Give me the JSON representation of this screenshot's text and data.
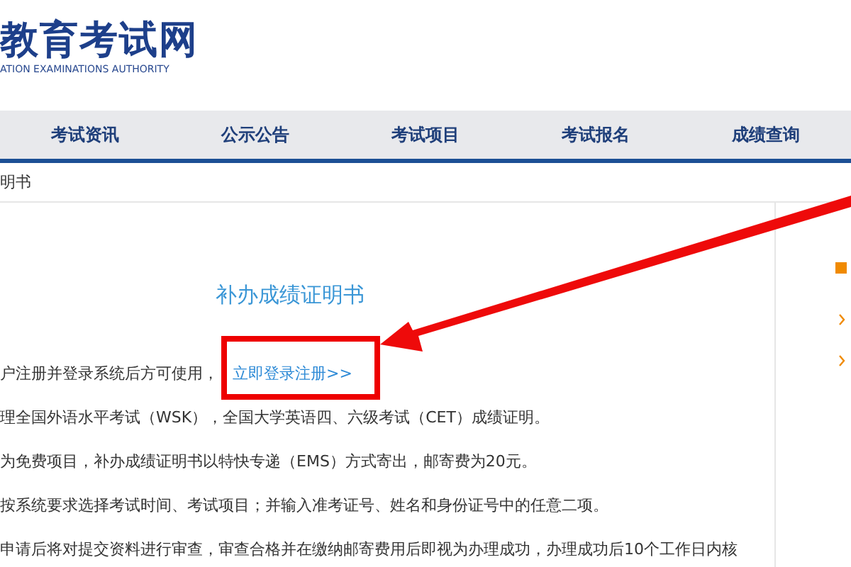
{
  "logo": {
    "title": "教育考试网",
    "subtitle": "ATION EXAMINATIONS AUTHORITY"
  },
  "nav": [
    {
      "label": "考试资讯"
    },
    {
      "label": "公示公告"
    },
    {
      "label": "考试项目"
    },
    {
      "label": "考试报名"
    },
    {
      "label": "成绩查询"
    }
  ],
  "breadcrumb": "明书",
  "article": {
    "title": "补办成绩证明书",
    "notice": {
      "text": "户注册并登录系统后方可使用，",
      "link": "立即登录注册>>"
    },
    "paragraphs": [
      "理全国外语水平考试（WSK），全国大学英语四、六级考试（CET）成绩证明。",
      "为免费项目，补办成绩证明书以特快专递（EMS）方式寄出，邮寄费为20元。",
      "按系统要求选择考试时间、考试项目；并输入准考证号、姓名和身份证号中的任意二项。",
      "申请后将对提交资料进行审查，审查合格并在缴纳邮寄费用后即视为办理成功，办理成功后10个工作日内核"
    ]
  }
}
